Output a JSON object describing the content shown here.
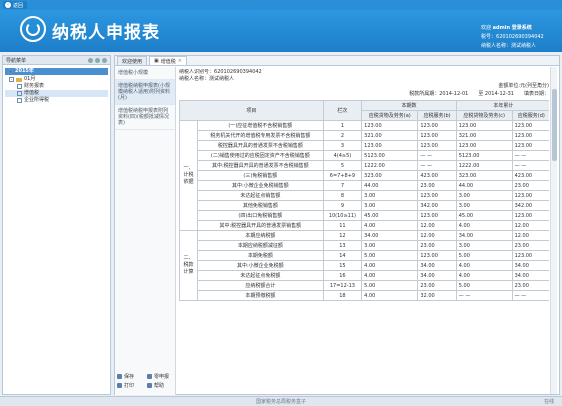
{
  "topbar": {
    "back_label": "返回"
  },
  "banner": {
    "title": "纳税人申报表"
  },
  "user": {
    "welcome_label": "欢迎",
    "welcome_value": "admin 登录系统",
    "tax_id_label": "税号：",
    "tax_id_value": "620102690394042",
    "taxpayer_label": "纳税人名称：",
    "taxpayer_value": "测试纳税人"
  },
  "nav": {
    "header": "导航菜单",
    "year": "2015年",
    "items": [
      {
        "label": "01月"
      },
      {
        "label": "财务报表"
      },
      {
        "label": "增值税"
      },
      {
        "label": "企业所得税"
      }
    ]
  },
  "tabs": [
    {
      "label": "欢迎使用"
    },
    {
      "label": "增值税"
    }
  ],
  "side": {
    "items": [
      {
        "label": "增值税小规模"
      },
      {
        "label": "增值税纳税申报表(小规模纳税人适用)附列资料(月)"
      },
      {
        "label": "增值税纳税申报表附列资料(四)(税额抵减情况表)"
      }
    ],
    "actions": [
      {
        "label": "保存"
      },
      {
        "label": "零申报"
      },
      {
        "label": "打印"
      },
      {
        "label": "帮助"
      }
    ]
  },
  "form": {
    "tax_id_label": "纳税人识别号：",
    "tax_id_value": "620102690394042",
    "name_label": "纳税人名称：",
    "name_value": "测试纳税人",
    "unit": "金额单位:元(列至角分)",
    "period_label": "税款所属期：",
    "period_from": "2014-12-01",
    "period_to_label": "至",
    "period_to": "2014-12-31",
    "fill_date_label": "填表日期："
  },
  "table": {
    "headers": {
      "item": "项目",
      "row": "栏次",
      "this_period": "本期数",
      "ytd": "本年累计",
      "a": "应税货物及劳务(a)",
      "b": "应税服务(b)",
      "c": "应税货物及劳务(c)",
      "d": "应税服务(d)"
    },
    "group1": "一、计税依据",
    "group2": "二、税款计算",
    "rows": [
      {
        "item": "(一)应征增值税不含税销售额",
        "row": "1",
        "a": "123.00",
        "b": "123.00",
        "c": "123.00",
        "d": "123.00"
      },
      {
        "item": "税务机关代开的增值税专用发票不含税销售额",
        "row": "2",
        "a": "321.00",
        "b": "123.00",
        "c": "321.00",
        "d": "123.00"
      },
      {
        "item": "税控器具开具的普通发票不含税销售额",
        "row": "3",
        "a": "123.00",
        "b": "123.00",
        "c": "123.00",
        "d": "123.00"
      },
      {
        "item": "(二)销售使用过的应税固定资产不含税销售额",
        "row": "4(4≥5)",
        "a": "5123.00",
        "b": "— —",
        "c": "5123.00",
        "d": "— —"
      },
      {
        "item": "其中:税控器具开具的普通发票不含税销售额",
        "row": "5",
        "a": "1222.00",
        "b": "— —",
        "c": "1222.00",
        "d": "— —"
      },
      {
        "item": "(三)免税销售额",
        "row": "6=7+8+9",
        "a": "323.00",
        "b": "423.00",
        "c": "323.00",
        "d": "423.00"
      },
      {
        "item": "其中:小微企业免税销售额",
        "row": "7",
        "a": "44.00",
        "b": "23.00",
        "c": "44.00",
        "d": "23.00"
      },
      {
        "item": "未达起征点销售额",
        "row": "8",
        "a": "3.00",
        "b": "123.00",
        "c": "3.00",
        "d": "123.00"
      },
      {
        "item": "其他免税销售额",
        "row": "9",
        "a": "3.00",
        "b": "342.00",
        "c": "3.00",
        "d": "342.00"
      },
      {
        "item": "(四)出口免税销售额",
        "row": "10(10≥11)",
        "a": "45.00",
        "b": "123.00",
        "c": "45.00",
        "d": "123.00"
      },
      {
        "item": "其中:税控器具开具的普通发票销售额",
        "row": "11",
        "a": "4.00",
        "b": "12.00",
        "c": "4.00",
        "d": "12.00"
      },
      {
        "item": "本期应纳税额",
        "row": "12",
        "a": "34.00",
        "b": "12.00",
        "c": "34.00",
        "d": "12.00"
      },
      {
        "item": "本期应纳税额减征额",
        "row": "13",
        "a": "3.00",
        "b": "23.00",
        "c": "3.00",
        "d": "23.00"
      },
      {
        "item": "本期免税额",
        "row": "14",
        "a": "5.00",
        "b": "123.00",
        "c": "5.00",
        "d": "123.00"
      },
      {
        "item": "其中:小微企业免税额",
        "row": "15",
        "a": "4.00",
        "b": "34.00",
        "c": "4.00",
        "d": "34.00"
      },
      {
        "item": "未达起征点免税额",
        "row": "16",
        "a": "4.00",
        "b": "34.00",
        "c": "4.00",
        "d": "34.00"
      },
      {
        "item": "应纳税额合计",
        "row": "17=12-13",
        "a": "5.00",
        "b": "23.00",
        "c": "5.00",
        "d": "23.00"
      },
      {
        "item": "本期预缴税额",
        "row": "18",
        "a": "4.00",
        "b": "32.00",
        "c": "— —",
        "d": "— —"
      }
    ]
  },
  "status": {
    "center": "国家税务总局税务盒子",
    "right": "在线"
  }
}
